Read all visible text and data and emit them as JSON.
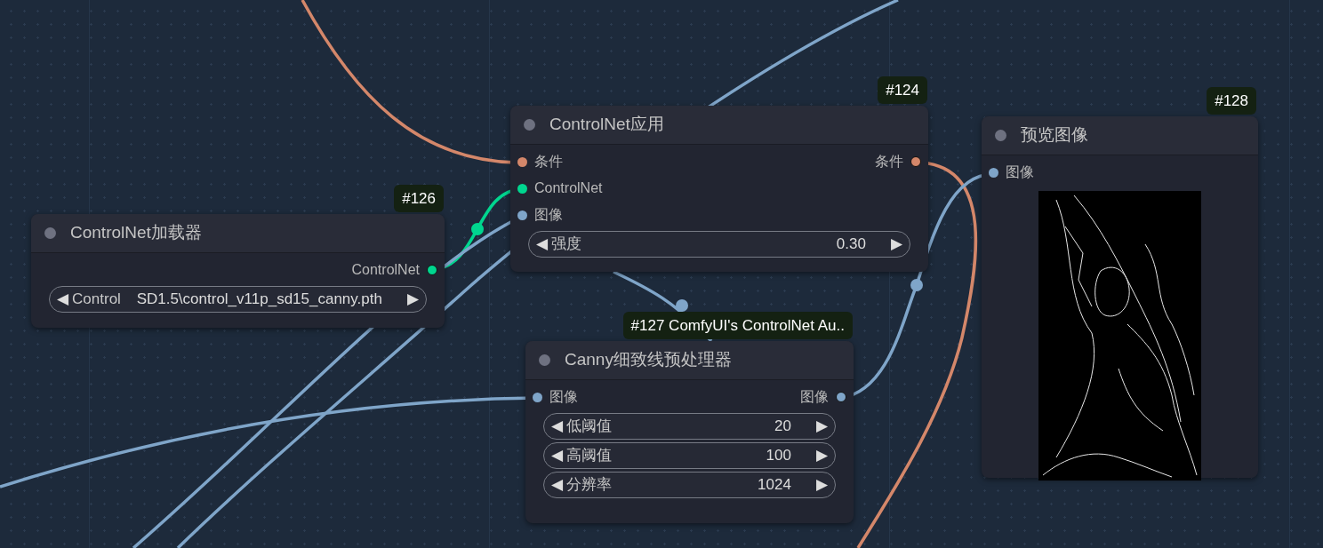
{
  "nodes": [
    {
      "badge": "#124",
      "title": "ControlNet应用",
      "inputs": [
        {
          "label": "条件",
          "color": "#d4876a"
        },
        {
          "label": "ControlNet",
          "color": "#00d68f"
        },
        {
          "label": "图像",
          "color": "#7fa5c9"
        }
      ],
      "outputs": [
        {
          "label": "条件",
          "color": "#d4876a"
        }
      ],
      "widgets": [
        {
          "dec": "◀",
          "label": "强度",
          "value": "0.30",
          "inc": "▶"
        }
      ]
    },
    {
      "badge": "#128",
      "title": "预览图像",
      "inputs": [
        {
          "label": "图像",
          "color": "#7fa5c9"
        }
      ]
    },
    {
      "badge": "#126",
      "title": "ControlNet加载器",
      "outputs": [
        {
          "label": "ControlNet",
          "color": "#00d68f"
        }
      ],
      "widgets": [
        {
          "dec": "◀",
          "label": "Control",
          "value": "SD1.5\\control_v11p_sd15_canny.pth",
          "inc": "▶"
        }
      ]
    },
    {
      "badge": "#127 ComfyUI's ControlNet Au..",
      "title": "Canny细致线预处理器",
      "inputs": [
        {
          "label": "图像",
          "color": "#7fa5c9"
        }
      ],
      "outputs": [
        {
          "label": "图像",
          "color": "#7fa5c9"
        }
      ],
      "widgets": [
        {
          "dec": "◀",
          "label": "低阈值",
          "value": "20",
          "inc": "▶"
        },
        {
          "dec": "◀",
          "label": "高阈值",
          "value": "100",
          "inc": "▶"
        },
        {
          "dec": "◀",
          "label": "分辨率",
          "value": "1024",
          "inc": "▶"
        }
      ]
    }
  ]
}
